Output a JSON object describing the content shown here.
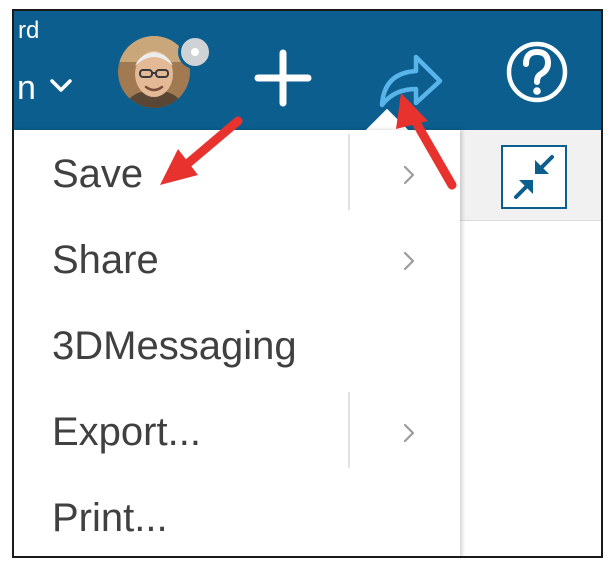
{
  "header": {
    "fragment_top": "rd",
    "fragment_bottom": "n"
  },
  "menu": {
    "items": [
      {
        "label": "Save",
        "has_submenu": true
      },
      {
        "label": "Share",
        "has_submenu": true
      },
      {
        "label": "3DMessaging",
        "has_submenu": false
      },
      {
        "label": "Export...",
        "has_submenu": true
      },
      {
        "label": "Print...",
        "has_submenu": false
      }
    ]
  },
  "icons": {
    "account_chevron": "chevron-down-icon",
    "avatar": "user-avatar",
    "status": "presence-status-icon",
    "add": "plus-icon",
    "share": "share-arrow-icon",
    "help": "help-question-icon",
    "collapse": "collapse-arrows-icon",
    "submenu": "chevron-right-icon",
    "annotation": "red-arrow-annotation"
  },
  "colors": {
    "header_bg": "#0b5e8e",
    "accent": "#1d86c8",
    "annotation": "#e8322e",
    "menu_text": "#404040"
  }
}
